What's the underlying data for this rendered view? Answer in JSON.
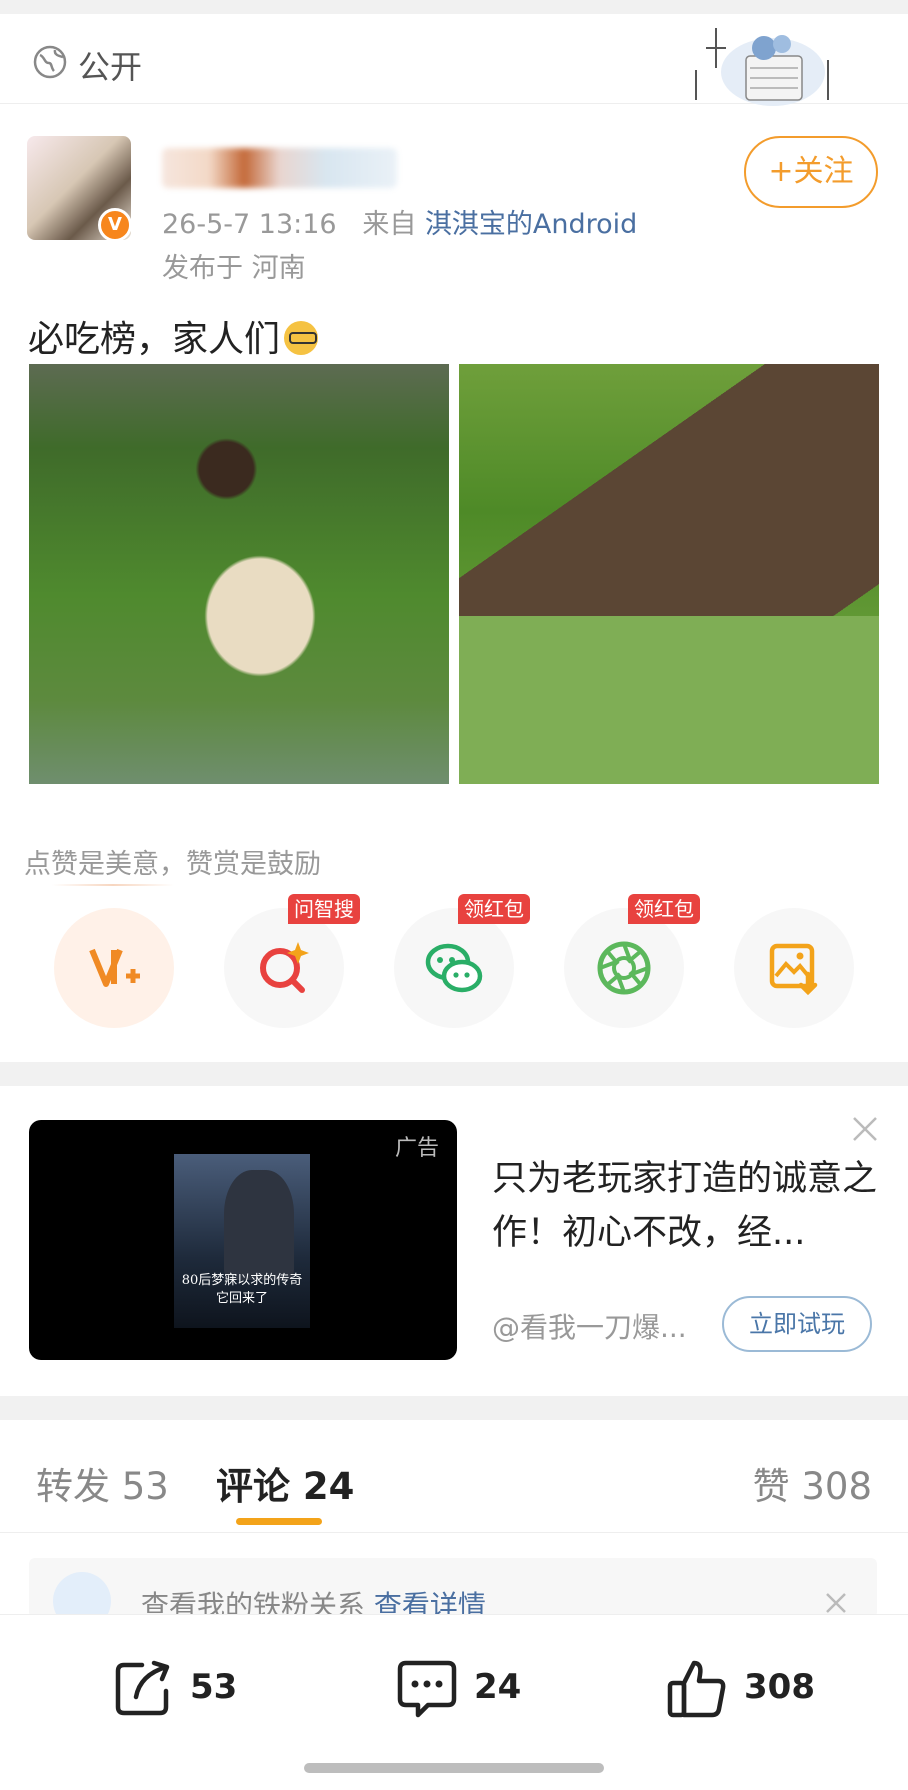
{
  "privacy": {
    "label": "公开"
  },
  "post": {
    "timestamp": "26-5-7 13:16",
    "source_prefix": "来自",
    "source": "淇淇宝的Android",
    "location": "发布于 河南",
    "follow_label": "+关注",
    "text": "必吃榜，家人们",
    "emoji": "nerd-face"
  },
  "reward": {
    "text": "点赞是美意，赞赏是鼓励",
    "actions": [
      {
        "icon": "v-plus-icon",
        "badge": ""
      },
      {
        "icon": "ai-search-icon",
        "badge": "问智搜"
      },
      {
        "icon": "wechat-icon",
        "badge": "领红包"
      },
      {
        "icon": "moments-icon",
        "badge": "领红包"
      },
      {
        "icon": "save-image-icon",
        "badge": ""
      }
    ]
  },
  "ad": {
    "label": "广告",
    "poster_text": "80后梦寐以求的传奇\n它回来了",
    "title": "只为老玩家打造的诚意之作！初心不改，经...",
    "handle": "@看我一刀爆...",
    "cta": "立即试玩"
  },
  "tabs": {
    "repost": "转发 53",
    "comment": "评论 24",
    "like": "赞 308"
  },
  "fan_bar": {
    "text": "查看我的铁粉关系",
    "link": "查看详情"
  },
  "bottom_bar": {
    "share_count": "53",
    "comment_count": "24",
    "like_count": "308"
  },
  "colors": {
    "accent": "#f39c2c",
    "link": "#4a6fa1",
    "badge": "#e8423f",
    "tab_indicator": "#f3a31a"
  }
}
